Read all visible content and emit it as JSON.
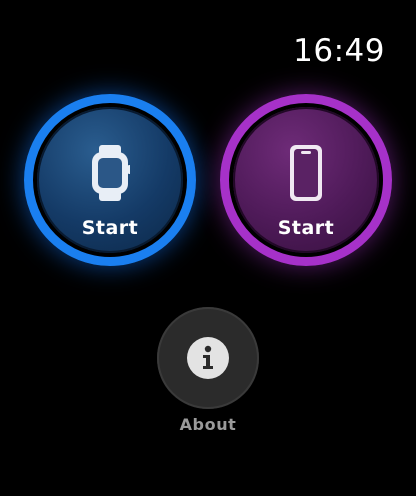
{
  "status_bar": {
    "time": "16:49"
  },
  "actions": {
    "watch_start": {
      "label": "Start",
      "icon": "apple-watch-icon",
      "accent_color": "#1a7ff0"
    },
    "phone_start": {
      "label": "Start",
      "icon": "iphone-icon",
      "accent_color": "#a631c9"
    },
    "about": {
      "label": "About",
      "icon": "info-icon"
    }
  }
}
